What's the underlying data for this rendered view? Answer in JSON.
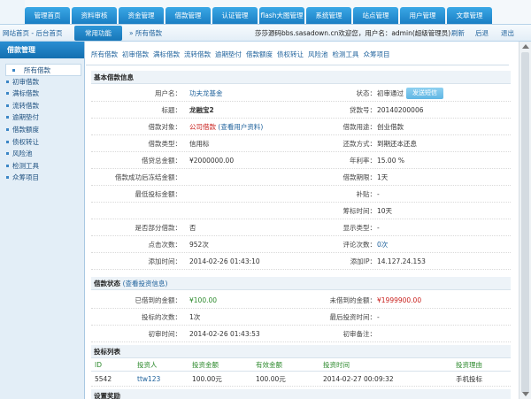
{
  "topnav": {
    "items": [
      "管理首页",
      "资料审核",
      "资金管理",
      "借款管理",
      "认证管理",
      "flash大图管理",
      "系统管理",
      "站点管理",
      "用户管理",
      "文章管理"
    ]
  },
  "subbar": {
    "home": "网站首页 - 后台首页",
    "quick": "常用功能",
    "crumb": "» 所有借款",
    "welcome": "莎莎源码bbs.sasadown.cn欢迎您，用户名：admin(超级管理员)",
    "refresh": "刷新",
    "back": "后退",
    "logout": "退出"
  },
  "sidebar": {
    "title": "借款管理",
    "items": [
      "所有借款",
      "初审借款",
      "满标借款",
      "流转借款",
      "逾期垫付",
      "借款额度",
      "债权转让",
      "风险池",
      "检测工具",
      "众筹项目"
    ]
  },
  "tabs": [
    "所有借款",
    "初审借款",
    "满标借款",
    "流转借款",
    "逾期垫付",
    "借款额度",
    "债权转让",
    "风险池",
    "检测工具",
    "众筹项目"
  ],
  "basic": {
    "title": "基本借款信息",
    "rows": [
      {
        "l1": "用户名：",
        "v1": "功夫龙基金",
        "l2": "状态：",
        "v2": "初审通过",
        "btn": "发送短信"
      },
      {
        "l1": "标题：",
        "v1": "龙融宝2",
        "l2": "贷款号：",
        "v2": "20140200006"
      },
      {
        "l1": "借款对象：",
        "v1": "公司借款",
        "v1b": "(查看用户资料)",
        "l2": "借款用途：",
        "v2": "创业借款"
      },
      {
        "l1": "借款类型：",
        "v1": "信用标",
        "l2": "还款方式：",
        "v2": "到期还本还息"
      },
      {
        "l1": "借贷总金额：",
        "v1": "¥2000000.00",
        "l2": "年利率：",
        "v2": "15.00 %"
      },
      {
        "l1": "借款成功后冻结金额：",
        "v1": "",
        "l2": "借款期限：",
        "v2": "1天"
      },
      {
        "l1": "最低投标金额：",
        "v1": "",
        "l2": "补贴：",
        "v2": "-"
      },
      {
        "l1": "",
        "v1": "",
        "l2": "筹标时间：",
        "v2": "10天"
      },
      {
        "l1": "是否部分借款：",
        "v1": "否",
        "l2": "显示类型：",
        "v2": "-"
      },
      {
        "l1": "点击次数：",
        "v1": "952次",
        "l2": "评论次数：",
        "v2": "0次"
      },
      {
        "l1": "添加时间：",
        "v1": "2014-02-26 01:43:10",
        "l2": "添加IP：",
        "v2": "14.127.24.153"
      }
    ]
  },
  "status": {
    "title": "借款状态",
    "link": "(查看投资信息)",
    "rows": [
      {
        "l1": "已借到的金额：",
        "v1": "¥100.00",
        "l2": "未借到的金额：",
        "v2": "¥1999900.00"
      },
      {
        "l1": "投标的次数：",
        "v1": "1次",
        "l2": "最后投资时间：",
        "v2": "-"
      },
      {
        "l1": "初审时间：",
        "v1": "2014-02-26 01:43:53",
        "l2": "初审备注：",
        "v2": ""
      }
    ]
  },
  "bids": {
    "title": "投标列表",
    "headers": [
      "ID",
      "投资人",
      "投资金额",
      "有效金额",
      "投资时间",
      "投资理由"
    ],
    "rows": [
      [
        "5542",
        "ttw123",
        "100.00元",
        "100.00元",
        "2014-02-27 00:09:32",
        "手机投标"
      ]
    ]
  },
  "next_section": "设置奖励",
  "colors": {
    "nav": "#1b7fc4",
    "link": "#1b5f9a",
    "red": "#c9211e",
    "green": "#2d8a2d"
  }
}
